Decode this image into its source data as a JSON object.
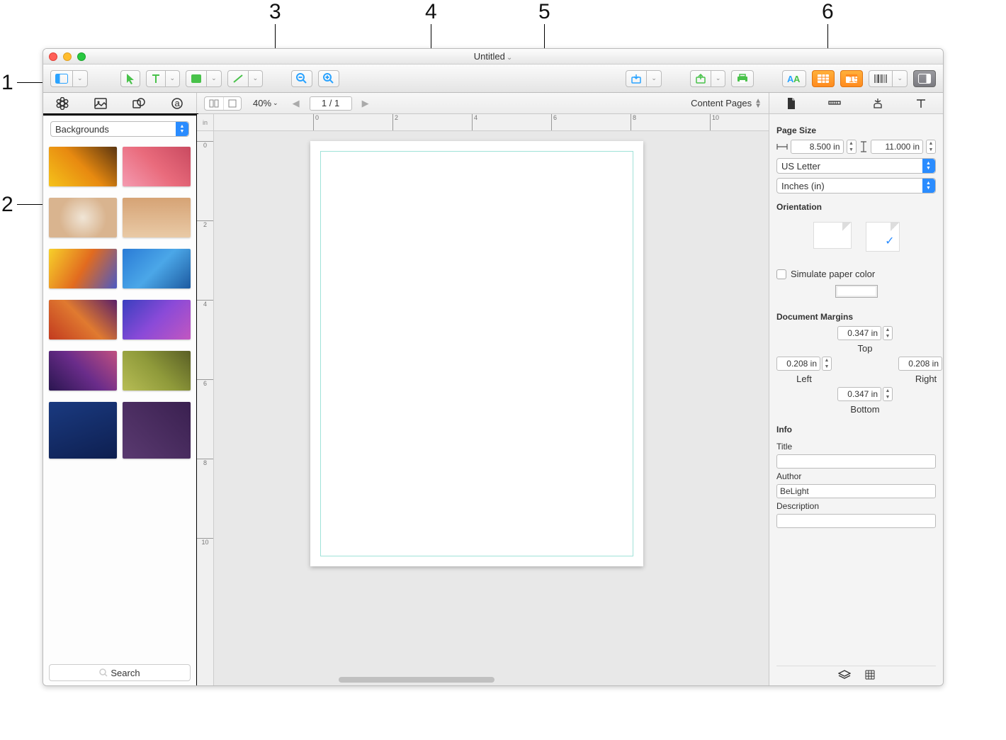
{
  "callouts": {
    "n1": "1",
    "n2": "2",
    "n3": "3",
    "n4": "4",
    "n5": "5",
    "n6": "6"
  },
  "window": {
    "title": "Untitled"
  },
  "sectoolbar": {
    "zoom": "40%",
    "page": "1 / 1",
    "content_pages": "Content Pages"
  },
  "source": {
    "dropdown": "Backgrounds",
    "search_placeholder": "Search"
  },
  "ruler": {
    "unit": "in",
    "h": [
      "0",
      "2",
      "4",
      "6",
      "8",
      "10"
    ],
    "v": [
      "0",
      "2",
      "4",
      "6",
      "8",
      "10"
    ]
  },
  "inspector": {
    "page_size_label": "Page Size",
    "width": "8.500 in",
    "height": "11.000 in",
    "preset": "US Letter",
    "unit": "Inches (in)",
    "orientation_label": "Orientation",
    "simulate_label": "Simulate paper color",
    "margins_label": "Document Margins",
    "margin_top": "0.347 in",
    "margin_left": "0.208 in",
    "margin_right": "0.208 in",
    "margin_bottom": "0.347 in",
    "top_l": "Top",
    "left_l": "Left",
    "right_l": "Right",
    "bottom_l": "Bottom",
    "info_label": "Info",
    "title_l": "Title",
    "author_l": "Author",
    "author": "BeLight",
    "desc_l": "Description"
  },
  "thumbs": [
    {
      "bg": "linear-gradient(45deg,#f5c21a,#e88a10,#5a3510)"
    },
    {
      "bg": "linear-gradient(45deg,#f49ab0,#e96b7c,#c94a60)"
    },
    {
      "bg": "radial-gradient(circle,#f0e5d6,#d9b48f 60%)",
      "dots": true
    },
    {
      "bg": "linear-gradient(0deg,#e9caa6,#d6a375)"
    },
    {
      "bg": "linear-gradient(120deg,#f7d02a,#e26b1f,#4b59c4)"
    },
    {
      "bg": "linear-gradient(135deg,#2a7bd6,#4ba7e8,#1d5aa0)"
    },
    {
      "bg": "linear-gradient(45deg,#c23a1f,#e07a30,#5a2068)"
    },
    {
      "bg": "linear-gradient(135deg,#3a3fbf,#8a4ad8,#c257c0)"
    },
    {
      "bg": "linear-gradient(45deg,#2a1650,#6a2c8a,#c05080)",
      "tall": true
    },
    {
      "bg": "linear-gradient(45deg,#b7bd55,#8f9a3a,#5a5f25)",
      "tall": true
    },
    {
      "bg": "linear-gradient(160deg,#1a3a80,#0e1f50)",
      "tall2": true
    },
    {
      "bg": "linear-gradient(45deg,#5a3a70,#3a2050)",
      "tall2": true
    }
  ]
}
